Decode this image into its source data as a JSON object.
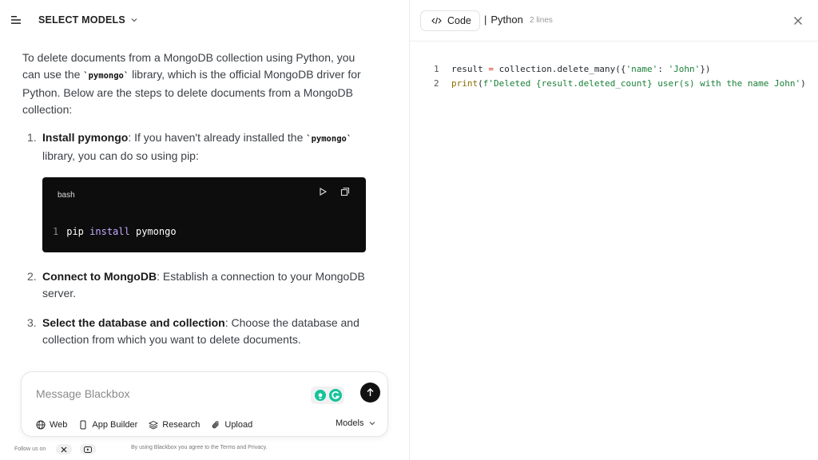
{
  "header": {
    "model_select_label": "SELECT MODELS"
  },
  "chat": {
    "intro": {
      "part1": "To delete documents from a MongoDB collection using Python, you can use the ",
      "lib": "`pymongo`",
      "part2": " library, which is the official MongoDB driver for Python. Below are the steps to delete documents from a MongoDB collection:"
    },
    "steps": [
      {
        "num": "1.",
        "title": "Install pymongo",
        "pre": ": If you haven't already installed the ",
        "lib": "`pymongo`",
        "post": " library, you can do so using pip:"
      },
      {
        "num": "2.",
        "title": "Connect to MongoDB",
        "text": ": Establish a connection to your MongoDB server."
      },
      {
        "num": "3.",
        "title": "Select the database and collection",
        "text": ": Choose the database and collection from which you want to delete documents."
      }
    ],
    "codeblock": {
      "lang": "bash",
      "line_no": "1",
      "cmd": "pip",
      "kw": "install",
      "arg": "pymongo"
    }
  },
  "composer": {
    "placeholder": "Message Blackbox",
    "tools": [
      "Web",
      "App Builder",
      "Research",
      "Upload"
    ],
    "models_label": "Models"
  },
  "footer": {
    "follow": "Follow us on",
    "terms": "By using Blackbox you agree to the Terms and Privacy."
  },
  "code_panel": {
    "tab_label": "Code",
    "separator": "|",
    "language": "Python",
    "line_count": "2 lines",
    "lines": [
      {
        "n": "1",
        "a": "result ",
        "b": "=",
        "c": " collection.delete_many({",
        "d": "'name'",
        "e": ": ",
        "f": "'John'",
        "g": "})"
      },
      {
        "n": "2",
        "a": "print",
        "b": "(",
        "c": "f'Deleted {result.deleted_count} user(s) with the name John'",
        "d": ")"
      }
    ]
  },
  "colors": {
    "accent_dark": "#111111",
    "code_bg": "#0d0d0d",
    "grammarly": "#15c39a"
  },
  "icons": [
    "hamburger-icon",
    "chevron-down-icon",
    "play-icon",
    "copy-icon",
    "arrow-up-icon",
    "globe-icon",
    "phone-icon",
    "layers-icon",
    "paperclip-icon",
    "x-logo-icon",
    "youtube-icon",
    "code-icon",
    "close-icon",
    "lightbulb-icon",
    "grammarly-icon"
  ]
}
